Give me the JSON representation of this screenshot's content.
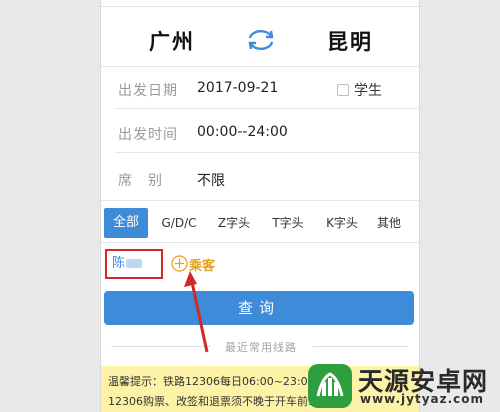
{
  "route": {
    "from": "广州",
    "to": "昆明"
  },
  "form": {
    "date_label": "出发日期",
    "date_value": "2017-09-21",
    "student_label": "学生",
    "time_label": "出发时间",
    "time_value": "00:00--24:00",
    "seat_label": "席　别",
    "seat_value": "不限"
  },
  "tabs": [
    {
      "label": "全部",
      "active": true
    },
    {
      "label": "G/D/C"
    },
    {
      "label": "Z字头"
    },
    {
      "label": "T字头"
    },
    {
      "label": "K字头"
    },
    {
      "label": "其他"
    }
  ],
  "passenger": {
    "name": "陈",
    "add_label": "乘客"
  },
  "query_label": "查询",
  "recent_label": "最近常用线路",
  "notice": {
    "line1": "温馨提示：铁路12306每日06:00~23:00",
    "line2": "12306购票、改签和退票须不晚于开车前30"
  },
  "watermark": {
    "title": "天源安卓网",
    "url": "www.jytyaz.com"
  },
  "colors": {
    "accent": "#3d8bd9",
    "highlight": "#d42727",
    "add": "#e5a11a",
    "notice_bg": "#fdf3a8"
  }
}
